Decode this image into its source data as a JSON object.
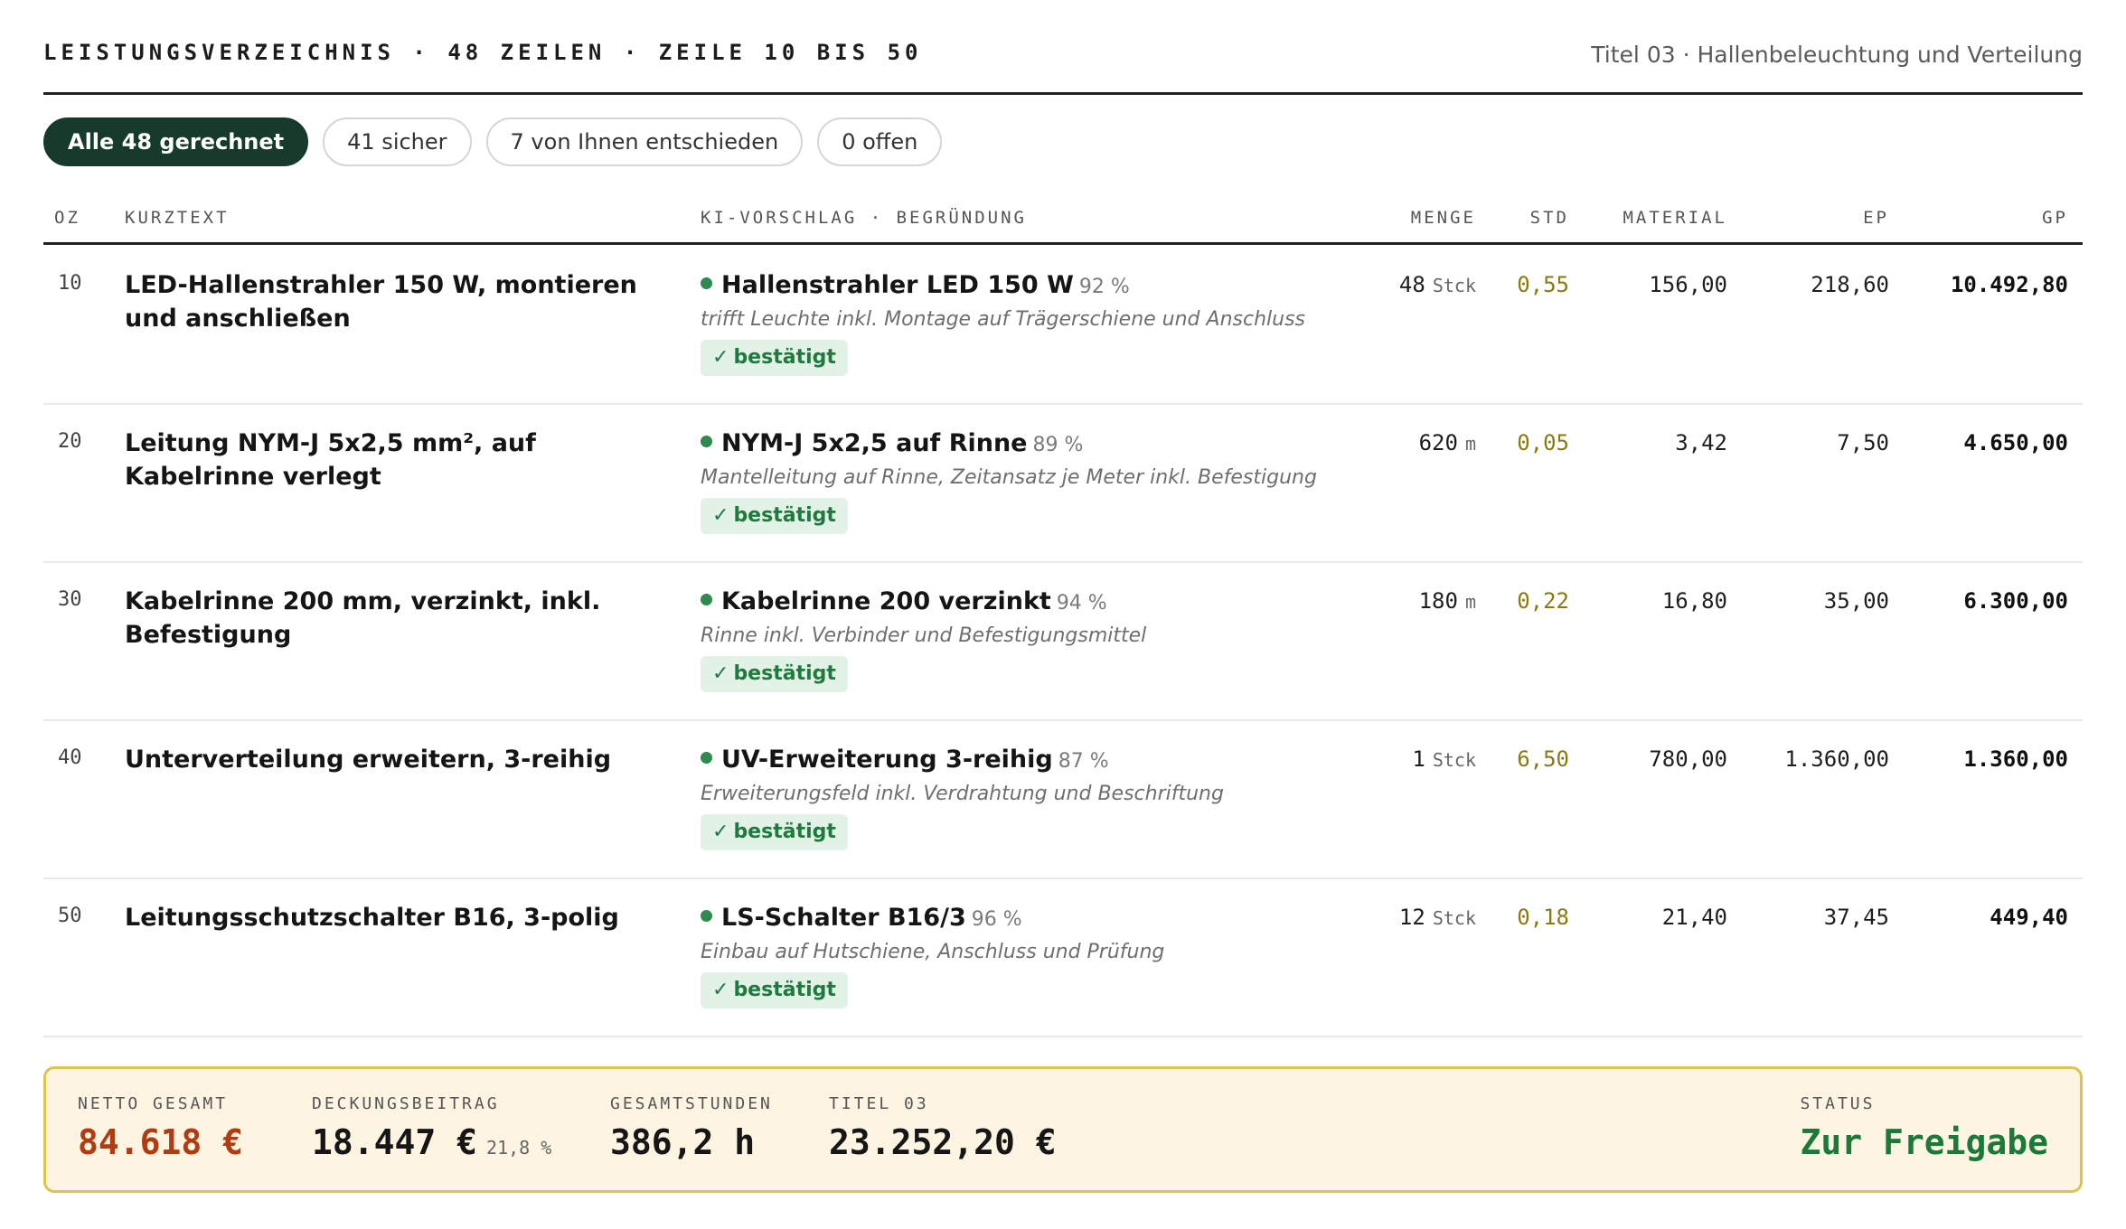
{
  "header": {
    "title": "LEISTUNGSVERZEICHNIS · 48 ZEILEN · ZEILE 10 BIS 50",
    "subtitle": "Titel 03 · Hallenbeleuchtung und Verteilung"
  },
  "filters": [
    {
      "label": "Alle 48 gerechnet",
      "active": true
    },
    {
      "label": "41 sicher",
      "active": false
    },
    {
      "label": "7 von Ihnen entschieden",
      "active": false
    },
    {
      "label": "0 offen",
      "active": false
    }
  ],
  "columns": {
    "oz": "OZ",
    "kurztext": "KURZTEXT",
    "ki": "KI-VORSCHLAG · BEGRÜNDUNG",
    "menge": "MENGE",
    "std": "STD",
    "material": "MATERIAL",
    "ep": "EP",
    "gp": "GP"
  },
  "rows": [
    {
      "oz": "10",
      "kurztext": "LED-Hallenstrahler 150 W, montieren und anschließen",
      "ki_title": "Hallenstrahler LED 150 W",
      "ki_pct": "92 %",
      "ki_desc": "trifft Leuchte inkl. Montage auf Trägerschiene und Anschluss",
      "badge": "bestätigt",
      "menge": "48",
      "unit": "Stck",
      "std": "0,55",
      "material": "156,00",
      "ep": "218,60",
      "gp": "10.492,80"
    },
    {
      "oz": "20",
      "kurztext": "Leitung NYM-J 5x2,5 mm², auf Kabelrinne verlegt",
      "ki_title": "NYM-J 5x2,5 auf Rinne",
      "ki_pct": "89 %",
      "ki_desc": "Mantelleitung auf Rinne, Zeitansatz je Meter inkl. Befestigung",
      "badge": "bestätigt",
      "menge": "620",
      "unit": "m",
      "std": "0,05",
      "material": "3,42",
      "ep": "7,50",
      "gp": "4.650,00"
    },
    {
      "oz": "30",
      "kurztext": "Kabelrinne 200 mm, verzinkt, inkl. Befestigung",
      "ki_title": "Kabelrinne 200 verzinkt",
      "ki_pct": "94 %",
      "ki_desc": "Rinne inkl. Verbinder und Befestigungsmittel",
      "badge": "bestätigt",
      "menge": "180",
      "unit": "m",
      "std": "0,22",
      "material": "16,80",
      "ep": "35,00",
      "gp": "6.300,00"
    },
    {
      "oz": "40",
      "kurztext": "Unterverteilung erweitern, 3-reihig",
      "ki_title": "UV-Erweiterung 3-reihig",
      "ki_pct": "87 %",
      "ki_desc": "Erweiterungsfeld inkl. Verdrahtung und Beschriftung",
      "badge": "bestätigt",
      "menge": "1",
      "unit": "Stck",
      "std": "6,50",
      "material": "780,00",
      "ep": "1.360,00",
      "gp": "1.360,00"
    },
    {
      "oz": "50",
      "kurztext": "Leitungsschutzschalter B16, 3-polig",
      "ki_title": "LS-Schalter B16/3",
      "ki_pct": "96 %",
      "ki_desc": "Einbau auf Hutschiene, Anschluss und Prüfung",
      "badge": "bestätigt",
      "menge": "12",
      "unit": "Stck",
      "std": "0,18",
      "material": "21,40",
      "ep": "37,45",
      "gp": "449,40"
    }
  ],
  "summary": {
    "netto_label": "NETTO GESAMT",
    "netto_value": "84.618 €",
    "deckung_label": "DECKUNGSBEITRAG",
    "deckung_value": "18.447 €",
    "deckung_pct": "21,8 %",
    "stunden_label": "GESAMTSTUNDEN",
    "stunden_value": "386,2 h",
    "titel_label": "TITEL 03",
    "titel_value": "23.252,20 €",
    "status_label": "STATUS",
    "status_value": "Zur Freigabe"
  },
  "colors": {
    "accent": "#163b2a",
    "confirmed": "#1f7a3d",
    "netto": "#b23c12",
    "status": "#1b7a3a",
    "std": "#8a7a12",
    "summary_bg": "#fdf4e2",
    "summary_border": "#e0c34a"
  }
}
